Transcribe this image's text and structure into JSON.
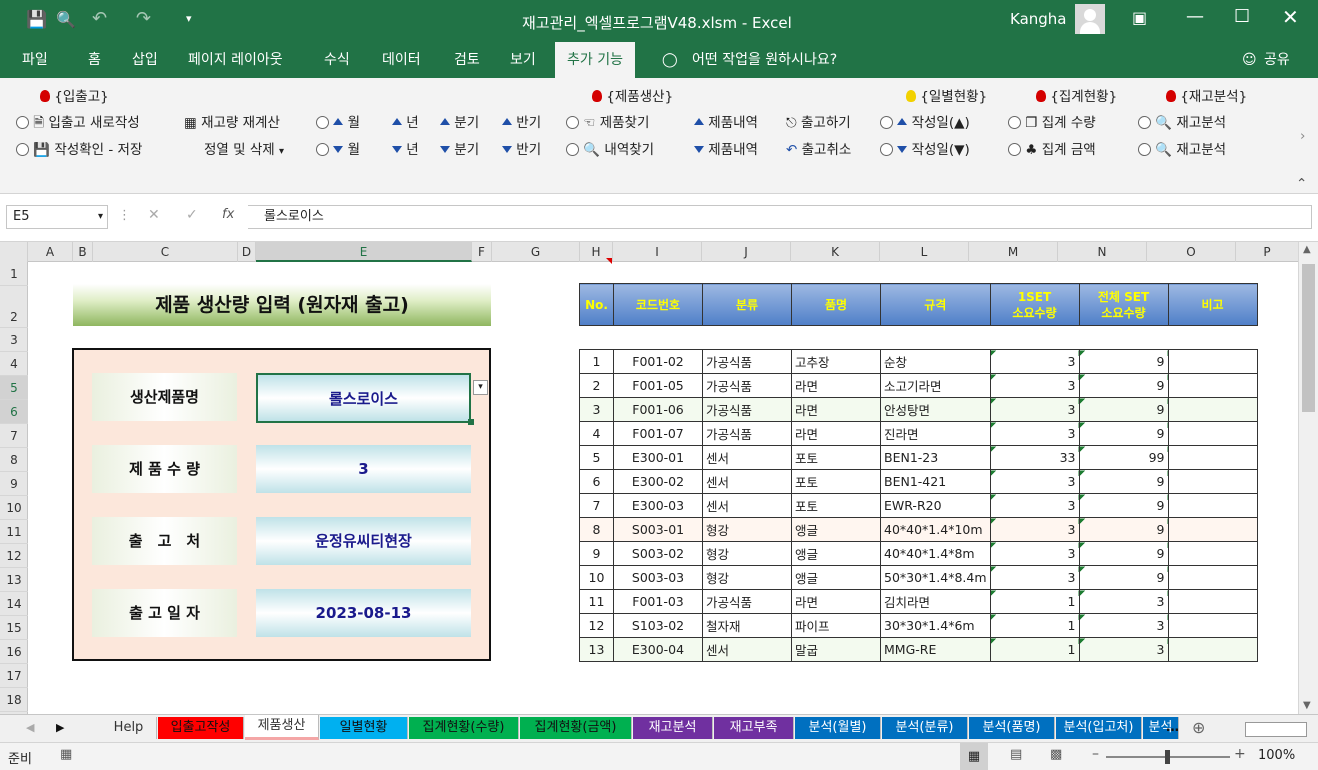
{
  "window": {
    "title": "재고관리_엑셀프로그램V48.xlsm  -  Excel",
    "user": "Kangha"
  },
  "ribbon_tabs": [
    "파일",
    "홈",
    "삽입",
    "페이지 레이아웃",
    "수식",
    "데이터",
    "검토",
    "보기",
    "추가 기능"
  ],
  "tell_me": "어떤 작업을 원하시나요?",
  "share": "공유",
  "ribbon": {
    "group_inout": "{입출고}",
    "group_product": "{제품생산}",
    "group_daily": "{일별현황}",
    "group_summary": "{집계현황}",
    "group_stock": "{재고분석}",
    "new_inout": "입출고 새로작성",
    "recalc": "재고량 재계산",
    "save_check": "작성확인 - 저장",
    "sort_delete": "정열 및 삭제",
    "month": "월",
    "year": "년",
    "quarter": "분기",
    "half": "반기",
    "find_product": "제품찾기",
    "find_detail": "내역찾기",
    "product_detail": "제품내역",
    "ship": "출고하기",
    "ship_cancel": "출고취소",
    "date_asc": "작성일(▲)",
    "date_desc": "작성일(▼)",
    "sum_qty": "집계 수량",
    "sum_amt": "집계 금액",
    "stock_analysis": "재고분석"
  },
  "formula": {
    "name_box": "E5",
    "content": "롤스로이스"
  },
  "columns": [
    "A",
    "B",
    "C",
    "D",
    "E",
    "F",
    "G",
    "H",
    "I",
    "J",
    "K",
    "L",
    "M",
    "N",
    "O",
    "P"
  ],
  "rows": [
    "1",
    "2",
    "3",
    "4",
    "5",
    "6",
    "7",
    "8",
    "9",
    "10",
    "11",
    "12",
    "13",
    "14",
    "15",
    "16",
    "17",
    "18"
  ],
  "form": {
    "title": "제품 생산량 입력 (원자재 출고)",
    "labels": [
      "생산제품명",
      "제 품 수 량",
      "출　고　처",
      "출 고 일 자"
    ],
    "values": [
      "롤스로이스",
      "3",
      "운정유씨티현장",
      "2023-08-13"
    ]
  },
  "table": {
    "headers": [
      "No.",
      "코드번호",
      "분류",
      "품명",
      "규격",
      "1SET 소요수량",
      "전체 SET 소요수량",
      "비고"
    ],
    "rows": [
      [
        "1",
        "F001-02",
        "가공식품",
        "고추장",
        "순창",
        "3",
        "9",
        ""
      ],
      [
        "2",
        "F001-05",
        "가공식품",
        "라면",
        "소고기라면",
        "3",
        "9",
        ""
      ],
      [
        "3",
        "F001-06",
        "가공식품",
        "라면",
        "안성탕면",
        "3",
        "9",
        ""
      ],
      [
        "4",
        "F001-07",
        "가공식품",
        "라면",
        "진라면",
        "3",
        "9",
        ""
      ],
      [
        "5",
        "E300-01",
        "센서",
        "포토",
        "BEN1-23",
        "33",
        "99",
        ""
      ],
      [
        "6",
        "E300-02",
        "센서",
        "포토",
        "BEN1-421",
        "3",
        "9",
        ""
      ],
      [
        "7",
        "E300-03",
        "센서",
        "포토",
        "EWR-R20",
        "3",
        "9",
        ""
      ],
      [
        "8",
        "S003-01",
        "형강",
        "앵글",
        "40*40*1.4*10m",
        "3",
        "9",
        ""
      ],
      [
        "9",
        "S003-02",
        "형강",
        "앵글",
        "40*40*1.4*8m",
        "3",
        "9",
        ""
      ],
      [
        "10",
        "S003-03",
        "형강",
        "앵글",
        "50*30*1.4*8.4m",
        "3",
        "9",
        ""
      ],
      [
        "11",
        "F001-03",
        "가공식품",
        "라면",
        "김치라면",
        "1",
        "3",
        ""
      ],
      [
        "12",
        "S103-02",
        "철자재",
        "파이프",
        "30*30*1.4*6m",
        "1",
        "3",
        ""
      ],
      [
        "13",
        "E300-04",
        "센서",
        "말굽",
        "MMG-RE",
        "1",
        "3",
        ""
      ]
    ]
  },
  "sheet_tabs": [
    {
      "label": "Help",
      "bg": "#f0f0f0",
      "fg": "#333"
    },
    {
      "label": "입출고작성",
      "bg": "#ff0000",
      "fg": "#111"
    },
    {
      "label": "제품생산",
      "bg": "#ffffff",
      "fg": "#333"
    },
    {
      "label": "일별현황",
      "bg": "#00b0f0",
      "fg": "#111"
    },
    {
      "label": "집계현황(수량)",
      "bg": "#00b050",
      "fg": "#111"
    },
    {
      "label": "집계현황(금액)",
      "bg": "#00b050",
      "fg": "#111"
    },
    {
      "label": "재고분석",
      "bg": "#7030a0",
      "fg": "#fff"
    },
    {
      "label": "재고부족",
      "bg": "#7030a0",
      "fg": "#fff"
    },
    {
      "label": "분석(월별)",
      "bg": "#0070c0",
      "fg": "#fff"
    },
    {
      "label": "분석(분류)",
      "bg": "#0070c0",
      "fg": "#fff"
    },
    {
      "label": "분석(품명)",
      "bg": "#0070c0",
      "fg": "#fff"
    },
    {
      "label": "분석(입고처)",
      "bg": "#0070c0",
      "fg": "#fff"
    },
    {
      "label": "분석",
      "bg": "#0070c0",
      "fg": "#fff"
    }
  ],
  "status": {
    "ready": "준비",
    "zoom": "100%"
  }
}
